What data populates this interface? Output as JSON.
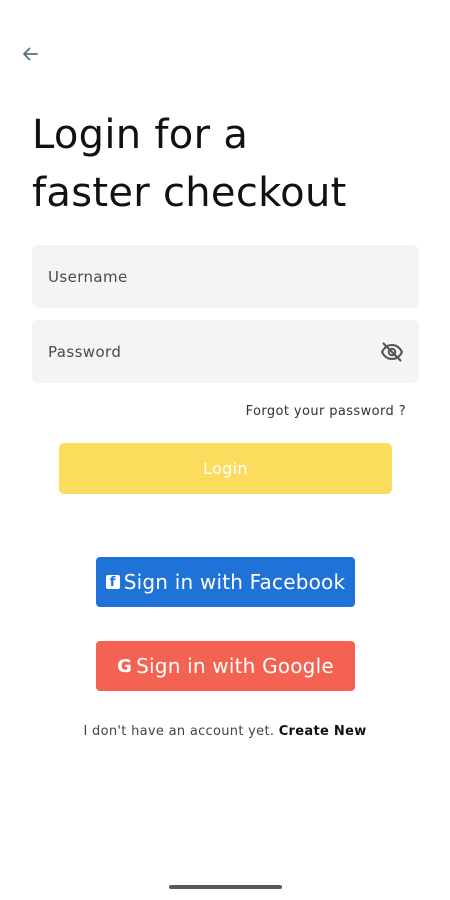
{
  "header": {
    "back_icon": "arrow-left-icon",
    "title_line1": "Login for a",
    "title_line2": "faster checkout"
  },
  "form": {
    "username": {
      "placeholder": "Username",
      "value": ""
    },
    "password": {
      "placeholder": "Password",
      "value": "",
      "toggle_icon": "eye-off-icon"
    },
    "forgot_label": "Forgot your password ?",
    "login_label": "Login"
  },
  "social": {
    "facebook": {
      "label": "Sign in with Facebook",
      "icon": "facebook-icon",
      "icon_glyph": "f",
      "color": "#1f72d8"
    },
    "google": {
      "label": "Sign in with Google",
      "icon": "google-icon",
      "icon_glyph": "G",
      "color": "#f46352"
    }
  },
  "signup": {
    "prompt": "I don't have an account yet. ",
    "link": "Create New"
  },
  "colors": {
    "login_button": "#fbdc5c",
    "field_background": "#f4f4f4"
  }
}
